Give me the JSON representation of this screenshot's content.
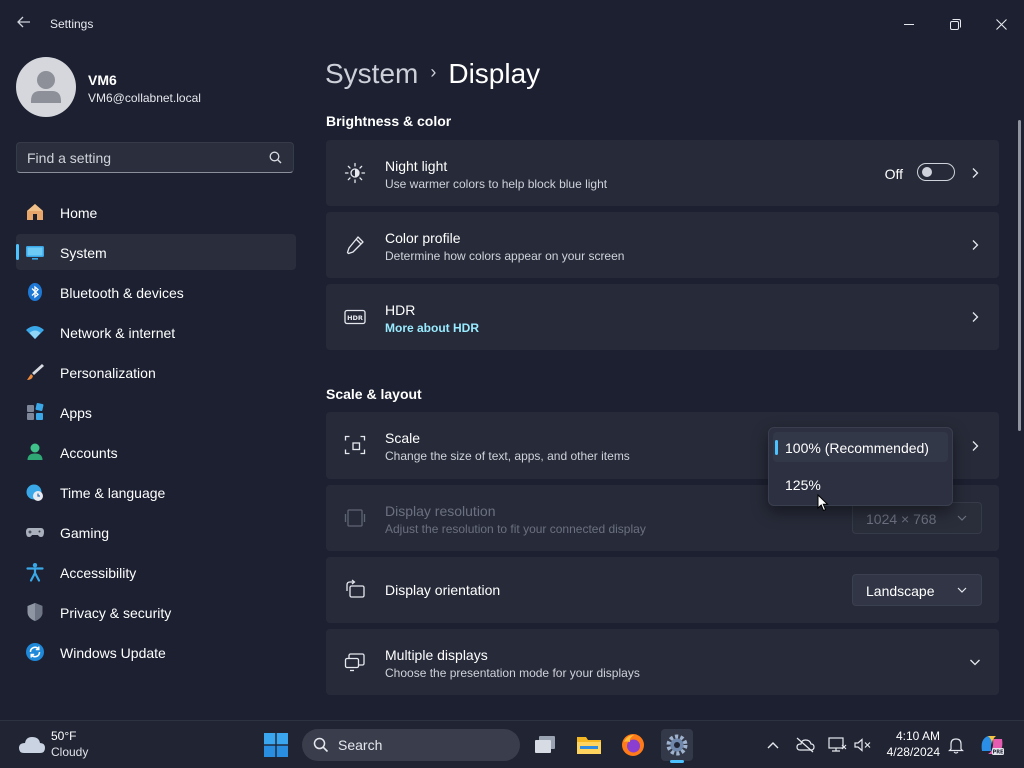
{
  "window": {
    "app_title": "Settings"
  },
  "profile": {
    "name": "VM6",
    "email": "VM6@collabnet.local"
  },
  "search": {
    "placeholder": "Find a setting"
  },
  "sidebar": {
    "items": [
      {
        "label": "Home",
        "icon": "home-icon"
      },
      {
        "label": "System",
        "icon": "system-icon",
        "active": true
      },
      {
        "label": "Bluetooth & devices",
        "icon": "bluetooth-icon"
      },
      {
        "label": "Network & internet",
        "icon": "wifi-icon"
      },
      {
        "label": "Personalization",
        "icon": "brush-icon"
      },
      {
        "label": "Apps",
        "icon": "apps-icon"
      },
      {
        "label": "Accounts",
        "icon": "person-icon"
      },
      {
        "label": "Time & language",
        "icon": "clock-globe-icon"
      },
      {
        "label": "Gaming",
        "icon": "gamepad-icon"
      },
      {
        "label": "Accessibility",
        "icon": "accessibility-icon"
      },
      {
        "label": "Privacy & security",
        "icon": "shield-icon"
      },
      {
        "label": "Windows Update",
        "icon": "update-icon"
      }
    ]
  },
  "breadcrumb": {
    "parent": "System",
    "separator": "›",
    "current": "Display"
  },
  "brightness_section": {
    "title": "Brightness & color",
    "night_light": {
      "title": "Night light",
      "subtitle": "Use warmer colors to help block blue light",
      "toggle_state": "Off"
    },
    "color_profile": {
      "title": "Color profile",
      "subtitle": "Determine how colors appear on your screen"
    },
    "hdr": {
      "title": "HDR",
      "link": "More about HDR"
    }
  },
  "layout_section": {
    "title": "Scale & layout",
    "scale": {
      "title": "Scale",
      "subtitle": "Change the size of text, apps, and other items",
      "options": [
        "100% (Recommended)",
        "125%"
      ],
      "selected_index": 0
    },
    "resolution": {
      "title": "Display resolution",
      "subtitle": "Adjust the resolution to fit your connected display",
      "value": "1024 × 768"
    },
    "orientation": {
      "title": "Display orientation",
      "value": "Landscape"
    },
    "multiple_displays": {
      "title": "Multiple displays",
      "subtitle": "Choose the presentation mode for your displays"
    }
  },
  "taskbar": {
    "weather": {
      "temp": "50°F",
      "condition": "Cloudy"
    },
    "search_label": "Search",
    "time": "4:10 AM",
    "date": "4/28/2024"
  },
  "colors": {
    "accent": "#4cc2ff",
    "link": "#99ebff",
    "card_bg": "#272b39",
    "window_bg": "#1c2030"
  }
}
